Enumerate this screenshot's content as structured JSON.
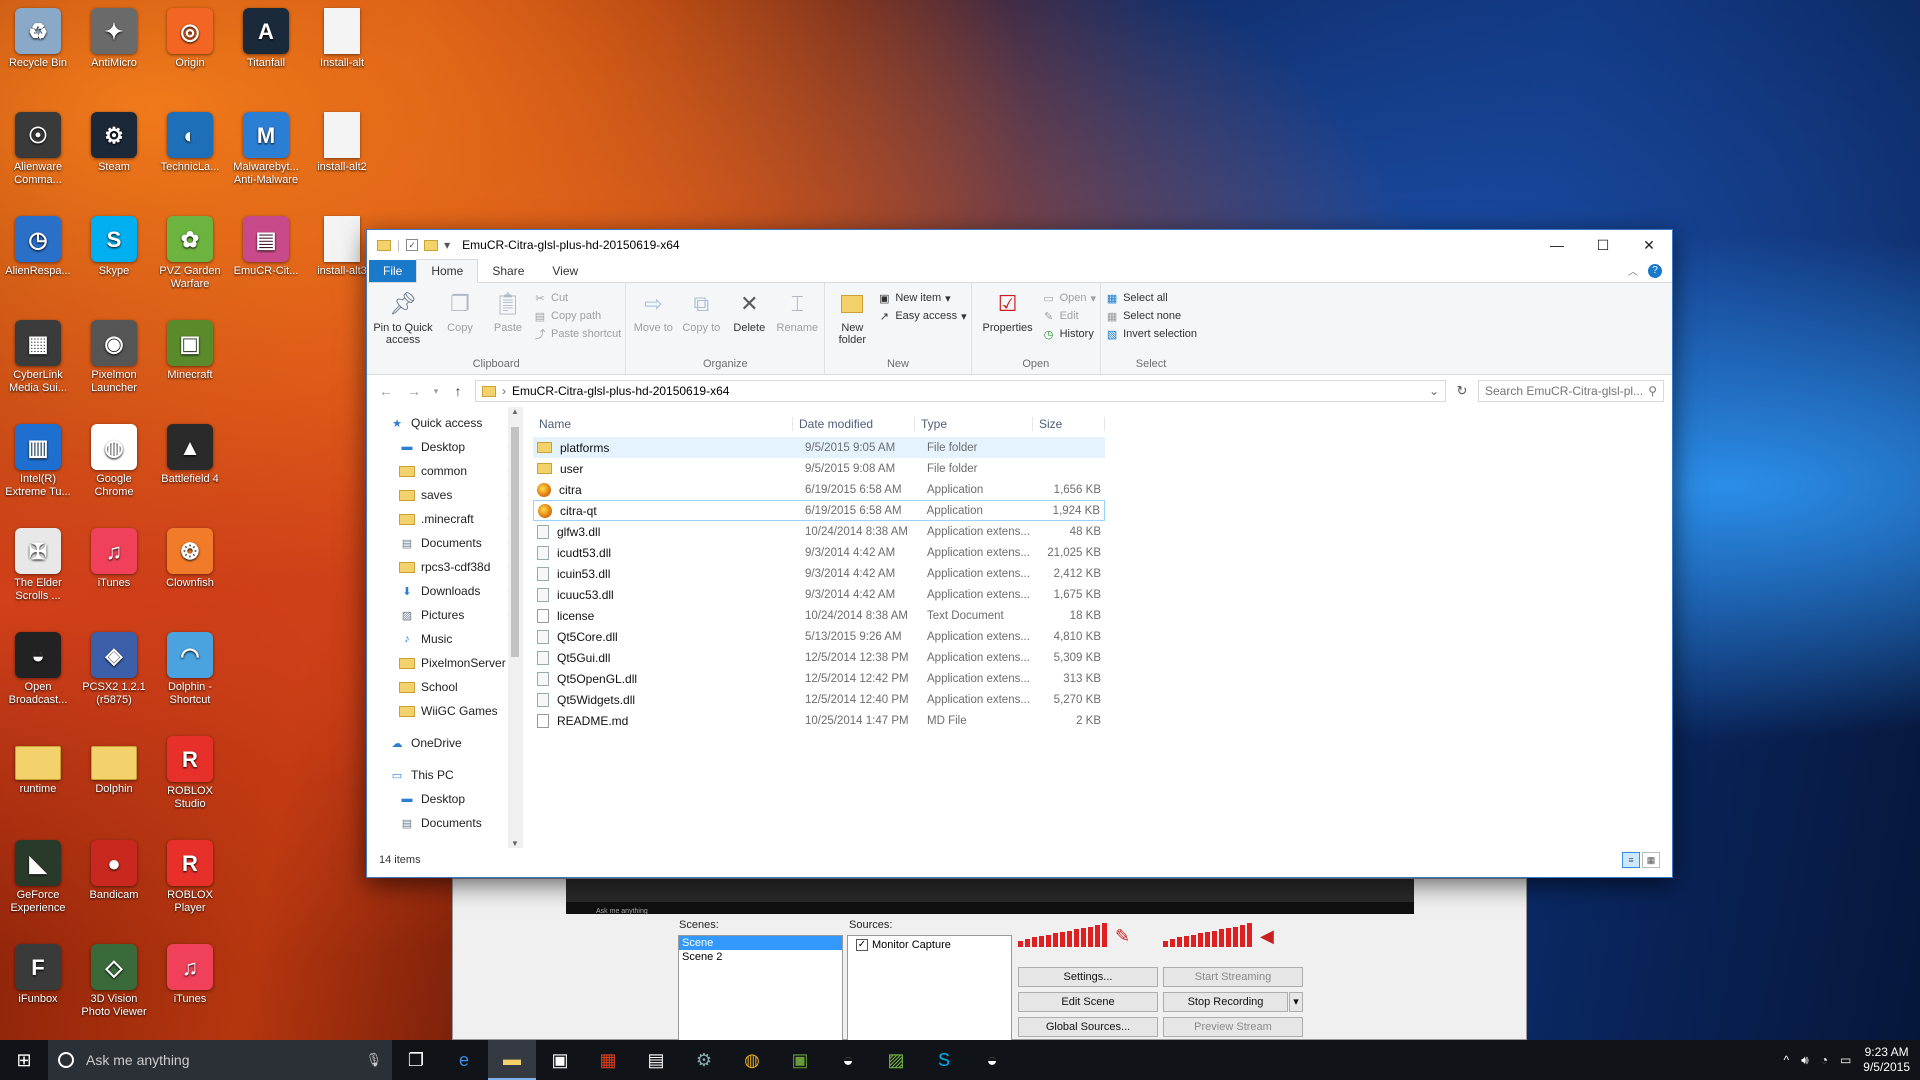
{
  "desktop": {
    "icons": [
      {
        "label": "Recycle Bin",
        "icon": "recycle-bin-icon",
        "color": "#8aa8c8",
        "glyph": "♻"
      },
      {
        "label": "AntiMicro",
        "icon": "gamepad-icon",
        "color": "#6a6a6a",
        "glyph": "✦"
      },
      {
        "label": "Origin",
        "icon": "origin-icon",
        "color": "#f26522",
        "glyph": "◎"
      },
      {
        "label": "Titanfall",
        "icon": "titanfall-icon",
        "color": "#1a2a3a",
        "glyph": "A"
      },
      {
        "label": "Install-alt",
        "icon": "file-icon",
        "color": "#f4f4f4",
        "glyph": ""
      },
      {
        "label": "Alienware Comma...",
        "icon": "alienware-icon",
        "color": "#3a3a3a",
        "glyph": "☉"
      },
      {
        "label": "Steam",
        "icon": "steam-icon",
        "color": "#1b2838",
        "glyph": "⚙"
      },
      {
        "label": "TechnicLa...",
        "icon": "technic-icon",
        "color": "#1d6fb8",
        "glyph": "◐"
      },
      {
        "label": "Malwarebyt... Anti-Malware",
        "icon": "malwarebytes-icon",
        "color": "#2a7fd4",
        "glyph": "M"
      },
      {
        "label": "install-alt2",
        "icon": "file-icon",
        "color": "#f4f4f4",
        "glyph": ""
      },
      {
        "label": "AlienRespa...",
        "icon": "alienrespawn-icon",
        "color": "#2a6fc8",
        "glyph": "◷"
      },
      {
        "label": "Skype",
        "icon": "skype-icon",
        "color": "#00aff0",
        "glyph": "S"
      },
      {
        "label": "PVZ Garden Warfare",
        "icon": "pvz-icon",
        "color": "#6cb33f",
        "glyph": "✿"
      },
      {
        "label": "EmuCR-Cit...",
        "icon": "winrar-icon",
        "color": "#c94a8a",
        "glyph": "▤"
      },
      {
        "label": "install-alt3",
        "icon": "file-icon",
        "color": "#f4f4f4",
        "glyph": ""
      },
      {
        "label": "CyberLink Media Sui...",
        "icon": "cyberlink-icon",
        "color": "#3b3b3b",
        "glyph": "▦"
      },
      {
        "label": "Pixelmon Launcher",
        "icon": "pixelmon-icon",
        "color": "#555",
        "glyph": "◉"
      },
      {
        "label": "Minecraft",
        "icon": "minecraft-icon",
        "color": "#5a8a2a",
        "glyph": "▣"
      },
      {
        "label": "",
        "icon": "blank-icon",
        "color": "transparent",
        "glyph": ""
      },
      {
        "label": "",
        "icon": "blank-icon",
        "color": "transparent",
        "glyph": ""
      },
      {
        "label": "Intel(R) Extreme Tu...",
        "icon": "intel-icon",
        "color": "#1f6fd0",
        "glyph": "▥"
      },
      {
        "label": "Google Chrome",
        "icon": "chrome-icon",
        "color": "#ffffff",
        "glyph": "◍"
      },
      {
        "label": "Battlefield 4",
        "icon": "battlefield-icon",
        "color": "#2a2a2a",
        "glyph": "▲"
      },
      {
        "label": "",
        "icon": "blank-icon",
        "color": "transparent",
        "glyph": ""
      },
      {
        "label": "",
        "icon": "blank-icon",
        "color": "transparent",
        "glyph": ""
      },
      {
        "label": "The Elder Scrolls ...",
        "icon": "skyrim-icon",
        "color": "#e8e8e8",
        "glyph": "✠"
      },
      {
        "label": "iTunes",
        "icon": "itunes-icon",
        "color": "#f0405a",
        "glyph": "♫"
      },
      {
        "label": "Clownfish",
        "icon": "clownfish-icon",
        "color": "#f27b2a",
        "glyph": "❂"
      },
      {
        "label": "",
        "icon": "blank-icon",
        "color": "transparent",
        "glyph": ""
      },
      {
        "label": "",
        "icon": "blank-icon",
        "color": "transparent",
        "glyph": ""
      },
      {
        "label": "Open Broadcast...",
        "icon": "obs-icon",
        "color": "#222",
        "glyph": "◒"
      },
      {
        "label": "PCSX2 1.2.1 (r5875)",
        "icon": "pcsx2-icon",
        "color": "#3b5fa8",
        "glyph": "◈"
      },
      {
        "label": "Dolphin - Shortcut",
        "icon": "dolphin-icon",
        "color": "#4aa3df",
        "glyph": "◠"
      },
      {
        "label": "",
        "icon": "blank-icon",
        "color": "transparent",
        "glyph": ""
      },
      {
        "label": "",
        "icon": "blank-icon",
        "color": "transparent",
        "glyph": ""
      },
      {
        "label": "runtime",
        "icon": "folder-icon",
        "color": "#f3d26b",
        "glyph": ""
      },
      {
        "label": "Dolphin",
        "icon": "folder-icon",
        "color": "#f3d26b",
        "glyph": ""
      },
      {
        "label": "ROBLOX Studio",
        "icon": "roblox-icon",
        "color": "#e8302a",
        "glyph": "R"
      },
      {
        "label": "",
        "icon": "blank-icon",
        "color": "transparent",
        "glyph": ""
      },
      {
        "label": "",
        "icon": "blank-icon",
        "color": "transparent",
        "glyph": ""
      },
      {
        "label": "GeForce Experience",
        "icon": "geforce-icon",
        "color": "#2a3a2a",
        "glyph": "◣"
      },
      {
        "label": "Bandicam",
        "icon": "bandicam-icon",
        "color": "#c8281e",
        "glyph": "●"
      },
      {
        "label": "ROBLOX Player",
        "icon": "roblox-icon",
        "color": "#e8302a",
        "glyph": "R"
      },
      {
        "label": "",
        "icon": "blank-icon",
        "color": "transparent",
        "glyph": ""
      },
      {
        "label": "",
        "icon": "blank-icon",
        "color": "transparent",
        "glyph": ""
      },
      {
        "label": "iFunbox",
        "icon": "ifunbox-icon",
        "color": "#3a3a3a",
        "glyph": "F"
      },
      {
        "label": "3D Vision Photo Viewer",
        "icon": "3dvision-icon",
        "color": "#3a6a3a",
        "glyph": "◇"
      },
      {
        "label": "iTunes",
        "icon": "itunes-icon",
        "color": "#f0405a",
        "glyph": "♫"
      }
    ]
  },
  "explorer": {
    "title": "EmuCR-Citra-glsl-plus-hd-20150619-x64",
    "ribbon_tabs": [
      "File",
      "Home",
      "Share",
      "View"
    ],
    "active_tab": "Home",
    "groups": {
      "clipboard": {
        "label": "Clipboard",
        "pin": "Pin to Quick access",
        "copy": "Copy",
        "paste": "Paste",
        "cut": "Cut",
        "copy_path": "Copy path",
        "paste_shortcut": "Paste shortcut"
      },
      "organize": {
        "label": "Organize",
        "move_to": "Move to",
        "copy_to": "Copy to",
        "delete": "Delete",
        "rename": "Rename"
      },
      "new": {
        "label": "New",
        "new_folder": "New folder",
        "new_item": "New item",
        "easy_access": "Easy access"
      },
      "open": {
        "label": "Open",
        "properties": "Properties",
        "open": "Open",
        "edit": "Edit",
        "history": "History"
      },
      "select": {
        "label": "Select",
        "select_all": "Select all",
        "select_none": "Select none",
        "invert": "Invert selection"
      }
    },
    "address": "EmuCR-Citra-glsl-plus-hd-20150619-x64",
    "search_placeholder": "Search EmuCR-Citra-glsl-pl...",
    "nav": [
      {
        "label": "Quick access",
        "icon": "star-icon",
        "level": 0,
        "pinned": false
      },
      {
        "label": "Desktop",
        "icon": "desktop-icon",
        "level": 1,
        "pinned": true
      },
      {
        "label": "common",
        "icon": "folder-icon",
        "level": 1,
        "pinned": true
      },
      {
        "label": "saves",
        "icon": "folder-icon",
        "level": 1,
        "pinned": true
      },
      {
        "label": ".minecraft",
        "icon": "folder-icon",
        "level": 1,
        "pinned": true
      },
      {
        "label": "Documents",
        "icon": "documents-icon",
        "level": 1,
        "pinned": true
      },
      {
        "label": "rpcs3-cdf38d",
        "icon": "folder-icon",
        "level": 1,
        "pinned": true
      },
      {
        "label": "Downloads",
        "icon": "downloads-icon",
        "level": 1,
        "pinned": true
      },
      {
        "label": "Pictures",
        "icon": "pictures-icon",
        "level": 1,
        "pinned": true
      },
      {
        "label": "Music",
        "icon": "music-icon",
        "level": 1,
        "pinned": false
      },
      {
        "label": "PixelmonServer",
        "icon": "folder-icon",
        "level": 1,
        "pinned": false
      },
      {
        "label": "School",
        "icon": "folder-icon",
        "level": 1,
        "pinned": false
      },
      {
        "label": "WiiGC Games",
        "icon": "folder-icon",
        "level": 1,
        "pinned": false
      },
      {
        "label": "",
        "icon": "spacer",
        "level": 0,
        "pinned": false
      },
      {
        "label": "OneDrive",
        "icon": "onedrive-icon",
        "level": 0,
        "pinned": false
      },
      {
        "label": "",
        "icon": "spacer",
        "level": 0,
        "pinned": false
      },
      {
        "label": "This PC",
        "icon": "pc-icon",
        "level": 0,
        "pinned": false
      },
      {
        "label": "Desktop",
        "icon": "desktop-icon",
        "level": 1,
        "pinned": false
      },
      {
        "label": "Documents",
        "icon": "documents-icon",
        "level": 1,
        "pinned": false
      }
    ],
    "columns": [
      "Name",
      "Date modified",
      "Type",
      "Size"
    ],
    "files": [
      {
        "name": "platforms",
        "date": "9/5/2015 9:05 AM",
        "type": "File folder",
        "size": "",
        "kind": "folder"
      },
      {
        "name": "user",
        "date": "9/5/2015 9:08 AM",
        "type": "File folder",
        "size": "",
        "kind": "folder"
      },
      {
        "name": "citra",
        "date": "6/19/2015 6:58 AM",
        "type": "Application",
        "size": "1,656 KB",
        "kind": "app"
      },
      {
        "name": "citra-qt",
        "date": "6/19/2015 6:58 AM",
        "type": "Application",
        "size": "1,924 KB",
        "kind": "app"
      },
      {
        "name": "glfw3.dll",
        "date": "10/24/2014 8:38 AM",
        "type": "Application extens...",
        "size": "48 KB",
        "kind": "dll"
      },
      {
        "name": "icudt53.dll",
        "date": "9/3/2014 4:42 AM",
        "type": "Application extens...",
        "size": "21,025 KB",
        "kind": "dll"
      },
      {
        "name": "icuin53.dll",
        "date": "9/3/2014 4:42 AM",
        "type": "Application extens...",
        "size": "2,412 KB",
        "kind": "dll"
      },
      {
        "name": "icuuc53.dll",
        "date": "9/3/2014 4:42 AM",
        "type": "Application extens...",
        "size": "1,675 KB",
        "kind": "dll"
      },
      {
        "name": "license",
        "date": "10/24/2014 8:38 AM",
        "type": "Text Document",
        "size": "18 KB",
        "kind": "txt"
      },
      {
        "name": "Qt5Core.dll",
        "date": "5/13/2015 9:26 AM",
        "type": "Application extens...",
        "size": "4,810 KB",
        "kind": "dll"
      },
      {
        "name": "Qt5Gui.dll",
        "date": "12/5/2014 12:38 PM",
        "type": "Application extens...",
        "size": "5,309 KB",
        "kind": "dll"
      },
      {
        "name": "Qt5OpenGL.dll",
        "date": "12/5/2014 12:42 PM",
        "type": "Application extens...",
        "size": "313 KB",
        "kind": "dll"
      },
      {
        "name": "Qt5Widgets.dll",
        "date": "12/5/2014 12:40 PM",
        "type": "Application extens...",
        "size": "5,270 KB",
        "kind": "dll"
      },
      {
        "name": "README.md",
        "date": "10/25/2014 1:47 PM",
        "type": "MD File",
        "size": "2 KB",
        "kind": "txt"
      }
    ],
    "status": "14 items"
  },
  "obs": {
    "scenes_label": "Scenes:",
    "sources_label": "Sources:",
    "scenes": [
      "Scene",
      "Scene 2"
    ],
    "sources": [
      "Monitor Capture"
    ],
    "buttons": {
      "settings": "Settings...",
      "start_streaming": "Start Streaming",
      "edit_scene": "Edit Scene",
      "stop_recording": "Stop Recording",
      "global_sources": "Global Sources...",
      "preview_stream": "Preview Stream"
    },
    "mini_search": "Ask me anything"
  },
  "taskbar": {
    "search_placeholder": "Ask me anything",
    "time": "9:23 AM",
    "date": "9/5/2015"
  },
  "colors": {
    "accent": "#1979ca",
    "selection": "#e5f3ff",
    "taskbar": "#101418"
  }
}
